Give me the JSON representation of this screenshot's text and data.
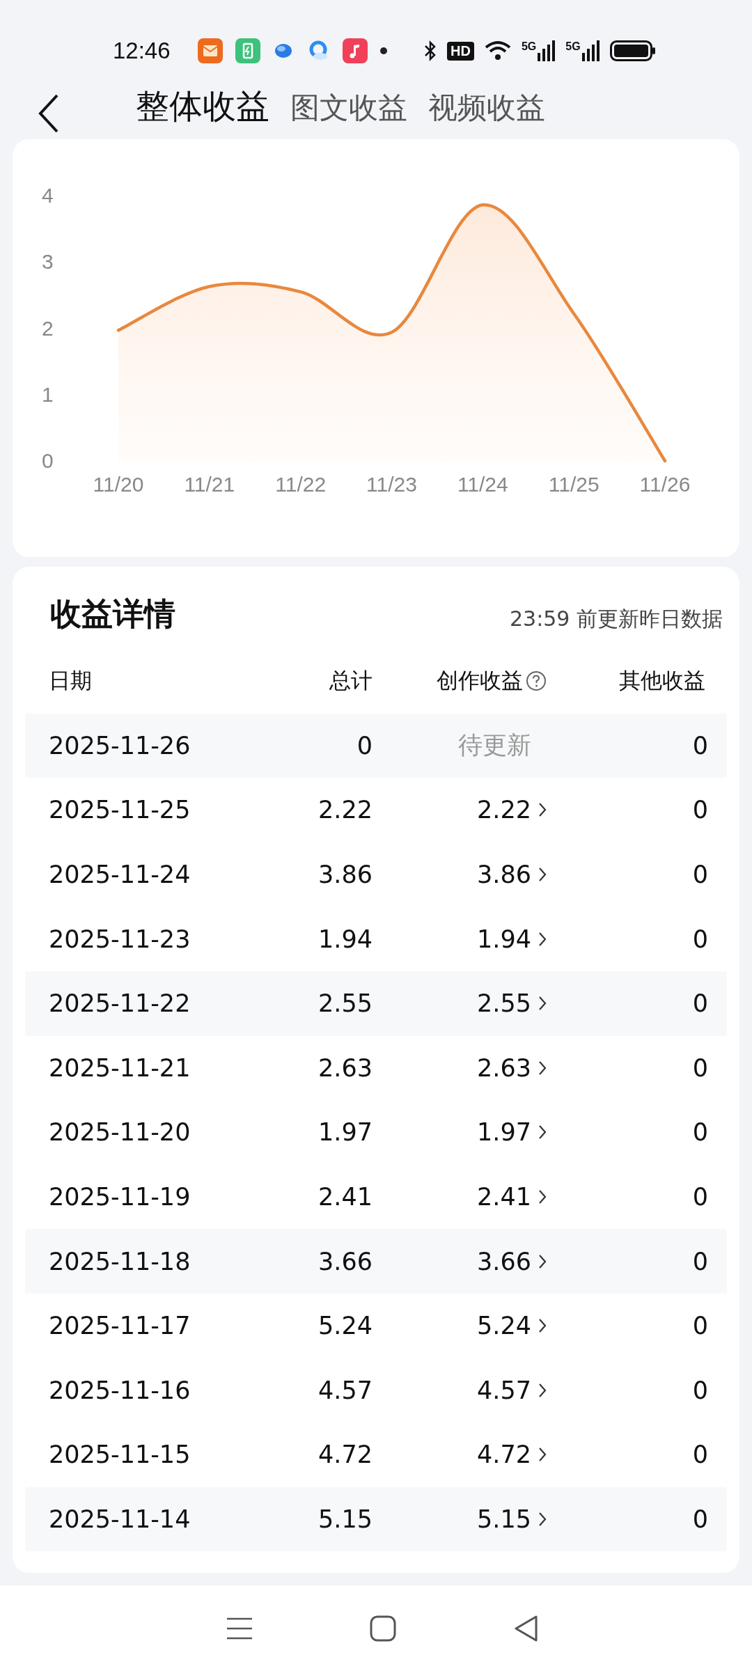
{
  "status_bar": {
    "time": "12:46",
    "hd": "HD",
    "sim1": "5G",
    "sim2": "5G"
  },
  "tabs": [
    {
      "label": "整体收益",
      "selected": true
    },
    {
      "label": "图文收益",
      "selected": false
    },
    {
      "label": "视频收益",
      "selected": false
    }
  ],
  "chart": {
    "chart_data": {
      "type": "line",
      "categories": [
        "11/20",
        "11/21",
        "11/22",
        "11/23",
        "11/24",
        "11/25",
        "11/26"
      ],
      "series": [
        {
          "color": "#e8883e",
          "values": [
            1.97,
            2.63,
            2.55,
            1.94,
            3.86,
            2.22,
            0
          ]
        }
      ],
      "ylim": [
        0,
        4
      ],
      "yticks": [
        0,
        1,
        2,
        3,
        4
      ]
    }
  },
  "details": {
    "title": "收益详情",
    "note": "23:59 前更新昨日数据",
    "columns": [
      "日期",
      "总计",
      "创作收益",
      "其他收益"
    ],
    "rows": [
      {
        "date": "2025-11-26",
        "total": "0",
        "creation": {
          "text": "待更新",
          "kind": "pending"
        },
        "other": "0"
      },
      {
        "date": "2025-11-25",
        "total": "2.22",
        "creation": {
          "text": "2.22",
          "kind": "link"
        },
        "other": "0"
      },
      {
        "date": "2025-11-24",
        "total": "3.86",
        "creation": {
          "text": "3.86",
          "kind": "link"
        },
        "other": "0"
      },
      {
        "date": "2025-11-23",
        "total": "1.94",
        "creation": {
          "text": "1.94",
          "kind": "link"
        },
        "other": "0"
      },
      {
        "date": "2025-11-22",
        "total": "2.55",
        "creation": {
          "text": "2.55",
          "kind": "link"
        },
        "other": "0"
      },
      {
        "date": "2025-11-21",
        "total": "2.63",
        "creation": {
          "text": "2.63",
          "kind": "link"
        },
        "other": "0"
      },
      {
        "date": "2025-11-20",
        "total": "1.97",
        "creation": {
          "text": "1.97",
          "kind": "link"
        },
        "other": "0"
      },
      {
        "date": "2025-11-19",
        "total": "2.41",
        "creation": {
          "text": "2.41",
          "kind": "link"
        },
        "other": "0"
      },
      {
        "date": "2025-11-18",
        "total": "3.66",
        "creation": {
          "text": "3.66",
          "kind": "link"
        },
        "other": "0"
      },
      {
        "date": "2025-11-17",
        "total": "5.24",
        "creation": {
          "text": "5.24",
          "kind": "link"
        },
        "other": "0"
      },
      {
        "date": "2025-11-16",
        "total": "4.57",
        "creation": {
          "text": "4.57",
          "kind": "link"
        },
        "other": "0"
      },
      {
        "date": "2025-11-15",
        "total": "4.72",
        "creation": {
          "text": "4.72",
          "kind": "link"
        },
        "other": "0"
      },
      {
        "date": "2025-11-14",
        "total": "5.15",
        "creation": {
          "text": "5.15",
          "kind": "link"
        },
        "other": "0"
      }
    ]
  }
}
